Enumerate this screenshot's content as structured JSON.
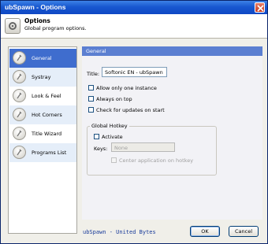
{
  "window": {
    "title": "ubSpawn - Options"
  },
  "header": {
    "title": "Options",
    "subtitle": "Global program options.",
    "icon": "settings-icon"
  },
  "nav": {
    "items": [
      {
        "label": "General",
        "icon": "tool-icon",
        "active": true
      },
      {
        "label": "Systray",
        "icon": "tool-icon",
        "active": false
      },
      {
        "label": "Look & Feel",
        "icon": "tool-icon",
        "active": false
      },
      {
        "label": "Hot Corners",
        "icon": "tool-icon",
        "active": false
      },
      {
        "label": "Title Wizard",
        "icon": "tool-icon",
        "active": false
      },
      {
        "label": "Programs List",
        "icon": "tool-icon",
        "active": false
      }
    ]
  },
  "content": {
    "section_title": "General",
    "title_label": "Title:",
    "title_value": "Softonic EN - ubSpawn",
    "options": [
      {
        "label": "Allow only one instance",
        "checked": false
      },
      {
        "label": "Always on top",
        "checked": false
      },
      {
        "label": "Check for updates on start",
        "checked": false
      }
    ],
    "hotkey": {
      "group_label": "Global Hotkey",
      "activate_label": "Activate",
      "keys_label": "Keys:",
      "keys_value": "None",
      "center_label": "Center application on hotkey"
    }
  },
  "footer": {
    "brand": "ubSpawn - United Bytes",
    "ok_label": "OK",
    "cancel_label": "Cancel"
  },
  "colors": {
    "titlebar": "#1858d0",
    "nav_active": "#3f6dce",
    "section_header": "#5b7fd1",
    "brand_text": "#1a3c9a"
  }
}
